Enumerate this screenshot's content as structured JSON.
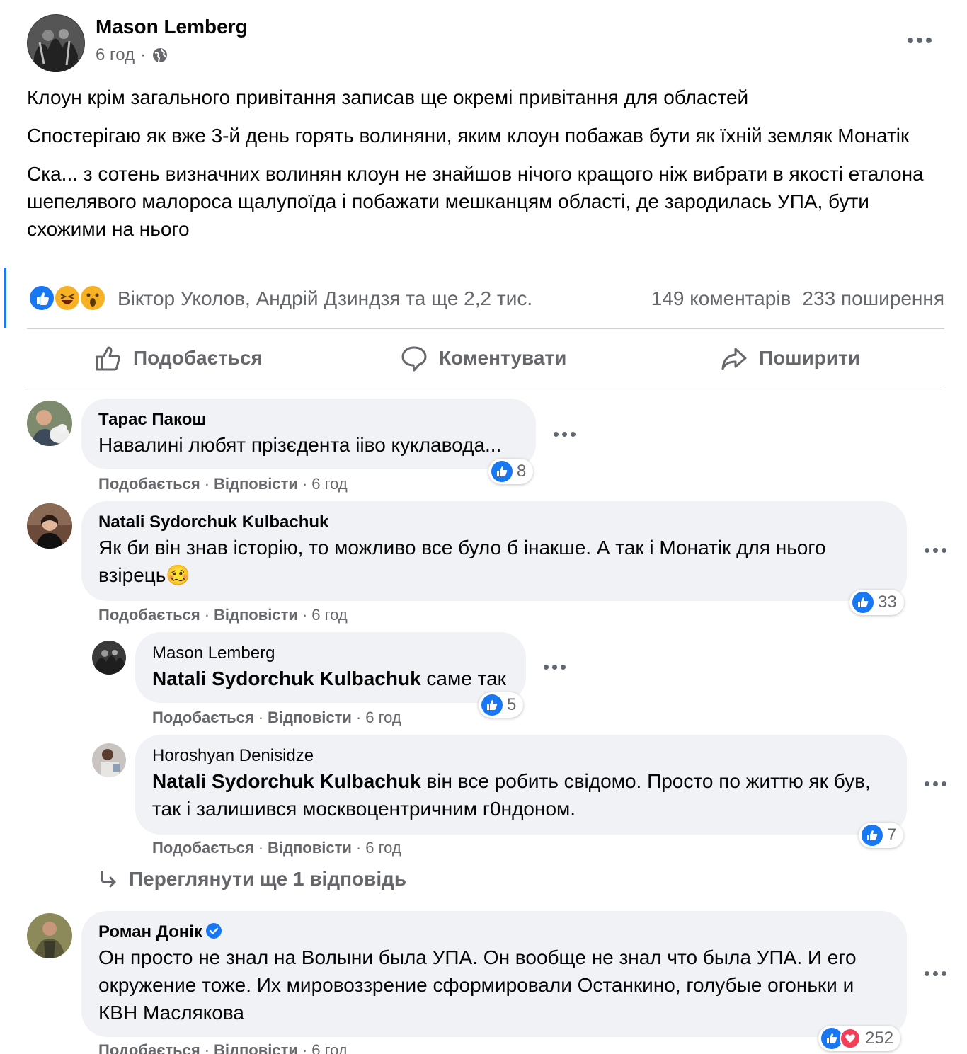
{
  "post": {
    "author": "Mason Lemberg",
    "time": "6 год",
    "separator": "·",
    "paragraphs": [
      "Клоун крім загального привітання записав ще окремі привітання для областей",
      "Спостерігаю як вже 3-й день горять волиняни, яким клоун побажав бути як їхній земляк Монатік",
      "Ска... з сотень визначних волинян клоун не знайшов нічого кращого ніж вибрати в якості еталона шепелявого малороса щалупоїда і побажати мешканцям області, де зародилась УПА, бути схожими на нього"
    ],
    "reactions_names": "Віктор Уколов, Андрій Дзиндзя та ще 2,2 тис.",
    "comments_count": "149 коментарів",
    "shares_count": "233 поширення"
  },
  "actions": {
    "like": "Подобається",
    "comment": "Коментувати",
    "share": "Поширити"
  },
  "comment_meta": {
    "like": "Подобається",
    "reply": "Відповісти",
    "dot": "·"
  },
  "comments": [
    {
      "name": "Тарас Пакош",
      "text": "Навалині любят прізєдента ііво куклавода...",
      "time": "6 год",
      "likes": "8"
    },
    {
      "name": "Natali Sydorchuk Kulbachuk",
      "text": "Як би він знав історію, то можливо все було б інакше. А так і Монатік для нього взірець",
      "emoji": "🥴",
      "time": "6 год",
      "likes": "33"
    },
    {
      "name": "Mason Lemberg",
      "mention": "Natali Sydorchuk Kulbachuk",
      "text": " саме так",
      "time": "6 год",
      "likes": "5"
    },
    {
      "name": "Horoshyan Denisidze",
      "mention": "Natali Sydorchuk Kulbachuk",
      "text": " він все робить свідомо. Просто по життю як був, так і залишився москвоцентричним г0ндоном.",
      "time": "6 год",
      "likes": "7"
    },
    {
      "name": "Роман Донік",
      "text": "Он просто не знал на Волыни была УПА. Он вообще не знал что была УПА. И его окружение тоже. Их мировоззрение сформировали Останкино, голубые огоньки и КВН Маслякова",
      "time": "6 год",
      "likes": "252"
    }
  ],
  "view_more_replies": "Переглянути ще 1 відповідь",
  "colors": {
    "like_blue": "#1877f2",
    "love_red": "#f33e58",
    "bubble_bg": "#f0f2f5",
    "secondary_text": "#65676b"
  }
}
